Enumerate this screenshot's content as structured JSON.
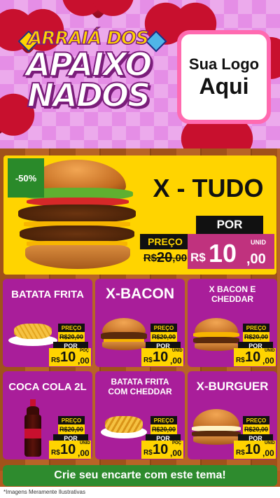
{
  "header": {
    "title_line1": "ARRAIÁ DOS",
    "title_line2": "APAIXO",
    "title_line3": "NADOS",
    "logo_line1": "Sua Logo",
    "logo_line2": "Aqui"
  },
  "hero": {
    "discount": "-50%",
    "name": "X - TUDO",
    "por_label": "POR",
    "preco_label": "PREÇO",
    "old_currency": "R$",
    "old_int": "20",
    "old_dec": ",00",
    "currency": "R$",
    "price_int": "10",
    "price_dec": ",00",
    "unit": "UNID"
  },
  "cards": [
    {
      "name": "BATATA FRITA",
      "preco_label": "PREÇO",
      "old_price": "R$20,00",
      "por_label": "POR",
      "currency": "R$",
      "price_int": "10",
      "price_dec": ",00",
      "unit": "POÇ"
    },
    {
      "name": "X-BACON",
      "preco_label": "PREÇO",
      "old_price": "R$20,00",
      "por_label": "POR",
      "currency": "R$",
      "price_int": "10",
      "price_dec": ",00",
      "unit": "UNID"
    },
    {
      "name": "X BACON E CHEDDAR",
      "preco_label": "PREÇO",
      "old_price": "R$20,00",
      "por_label": "POR",
      "currency": "R$",
      "price_int": "10",
      "price_dec": ",00",
      "unit": "UNID"
    },
    {
      "name": "COCA COLA 2L",
      "preco_label": "PREÇO",
      "old_price": "R$20,00",
      "por_label": "POR",
      "currency": "R$",
      "price_int": "10",
      "price_dec": ",00",
      "unit": "UNID"
    },
    {
      "name": "BATATA FRITA COM CHEDDAR",
      "preco_label": "PREÇO",
      "old_price": "R$20,00",
      "por_label": "POR",
      "currency": "R$",
      "price_int": "10",
      "price_dec": ",00",
      "unit": "POÇ"
    },
    {
      "name": "X-BURGUER",
      "preco_label": "PREÇO",
      "old_price": "R$20,00",
      "por_label": "POR",
      "currency": "R$",
      "price_int": "10",
      "price_dec": ",00",
      "unit": "UNID"
    }
  ],
  "footer": {
    "cta": "Crie seu encarte com este tema!",
    "disclaimer": "*Imagens Meramente Ilustrativas"
  },
  "colors": {
    "card_bg": "#a91e9a",
    "hero_bg": "#ffd400",
    "cta_bg": "#2e8b2e",
    "header_bg": "#e58ee6"
  }
}
